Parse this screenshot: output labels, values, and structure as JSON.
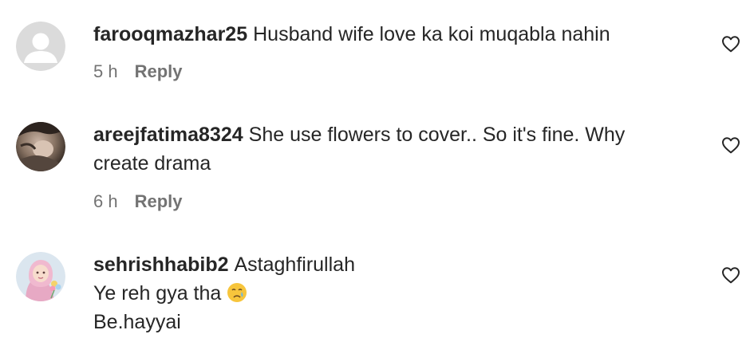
{
  "comments": [
    {
      "username": "farooqmazhar25",
      "text": "Husband wife love ka koi muqabla nahin",
      "time": "5 h",
      "reply_label": "Reply",
      "avatar": "default-profile-avatar"
    },
    {
      "username": "areejfatima8324",
      "text_line1": "She use flowers to cover.. So it's fine. Why",
      "text_line2": "create drama",
      "time": "6 h",
      "reply_label": "Reply",
      "avatar": "user-photo-avatar"
    },
    {
      "username": "sehrishhabib2",
      "text_line1": "Astaghfirullah",
      "text_line2": "Ye reh gya tha",
      "emoji": "crying-face-emoji",
      "text_line3": "Be.hayyai",
      "avatar": "illustrated-hijab-girl-avatar"
    }
  ],
  "icons": {
    "like": "heart-outline-icon"
  },
  "colors": {
    "text": "#262626",
    "muted": "#737373",
    "avatar_default_bg": "#dbdbdb"
  }
}
